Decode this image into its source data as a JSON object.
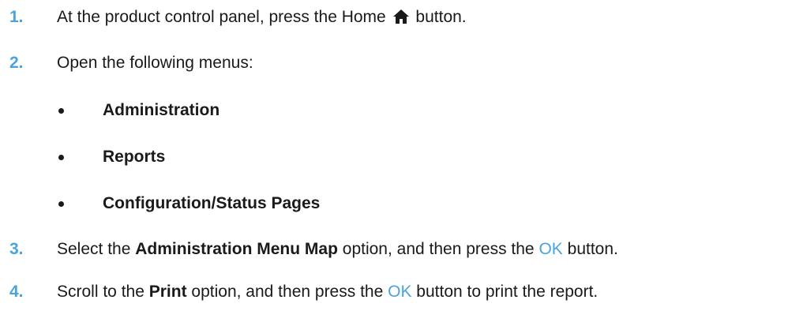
{
  "colors": {
    "step_number": "#4aa3df",
    "ok_text": "#4aa3df",
    "body_text": "#1a1a1a"
  },
  "steps": [
    {
      "number": "1.",
      "text_before": "At the product control panel, press the Home",
      "icon": "home-icon",
      "text_after": "button."
    },
    {
      "number": "2.",
      "text": "Open the following menus:"
    },
    {
      "number": "3.",
      "text_before": "Select the",
      "bold": "Administration Menu Map",
      "text_middle": "option, and then press the",
      "ok": "OK",
      "text_after": "button."
    },
    {
      "number": "4.",
      "text_before": "Scroll to the",
      "bold": "Print",
      "text_middle": "option, and then press the",
      "ok": "OK",
      "text_after": "button to print the report."
    }
  ],
  "menus": [
    "Administration",
    "Reports",
    "Configuration/Status Pages"
  ]
}
